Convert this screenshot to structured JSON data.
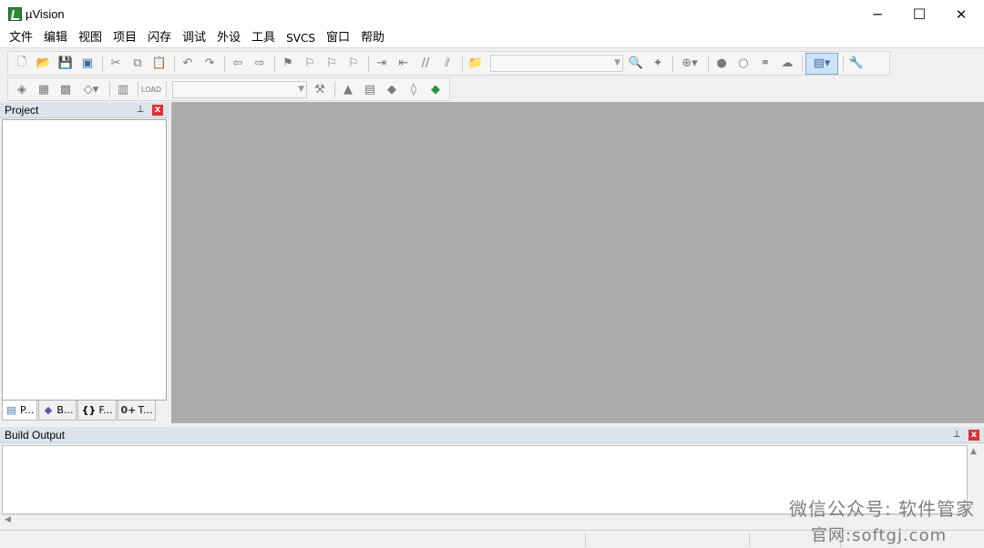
{
  "window": {
    "title": "µVision",
    "minimize_glyph": "─",
    "maximize_glyph": "☐",
    "close_glyph": "✕"
  },
  "menu": [
    "文件",
    "编辑",
    "视图",
    "项目",
    "闪存",
    "调试",
    "外设",
    "工具",
    "SVCS",
    "窗口",
    "帮助"
  ],
  "toolbar1": {
    "icons": [
      "new-file-icon",
      "open-file-icon",
      "save-icon",
      "save-all-icon",
      "cut-icon",
      "copy-icon",
      "paste-icon",
      "undo-icon",
      "redo-icon",
      "nav-back-icon",
      "nav-forward-icon",
      "bookmark-icon",
      "prev-bookmark-icon",
      "next-bookmark-icon",
      "clear-bookmarks-icon",
      "indent-icon",
      "unindent-icon",
      "comment-icon",
      "uncomment-icon",
      "find-in-files-icon",
      "find-icon",
      "incremental-find-icon",
      "debug-zoom-icon",
      "breakpoint-icon",
      "disable-breakpoint-icon",
      "disable-all-breakpoints-icon",
      "kill-all-breakpoints-icon",
      "window-layout-icon",
      "configure-icon"
    ]
  },
  "toolbar2": {
    "icons": [
      "translate-icon",
      "build-icon",
      "rebuild-icon",
      "batch-build-icon",
      "stop-build-icon",
      "download-icon",
      "target-options-icon",
      "manage-project-icon",
      "select-packs-icon",
      "manage-rte-icon",
      "pack-installer-icon"
    ]
  },
  "project_panel": {
    "title": "Project",
    "pin_glyph": "📌",
    "close_glyph": "x",
    "tabs": [
      {
        "label": "P...",
        "icon": "project-tab-icon"
      },
      {
        "label": "B...",
        "icon": "books-tab-icon"
      },
      {
        "label": "F...",
        "icon": "functions-tab-icon",
        "glyph": "{}"
      },
      {
        "label": "T...",
        "icon": "templates-tab-icon",
        "glyph": "0+"
      }
    ]
  },
  "build_panel": {
    "title": "Build Output",
    "close_glyph": "x"
  },
  "watermark": {
    "line1": "微信公众号: 软件管家",
    "line2": "官网:softgj.com"
  }
}
